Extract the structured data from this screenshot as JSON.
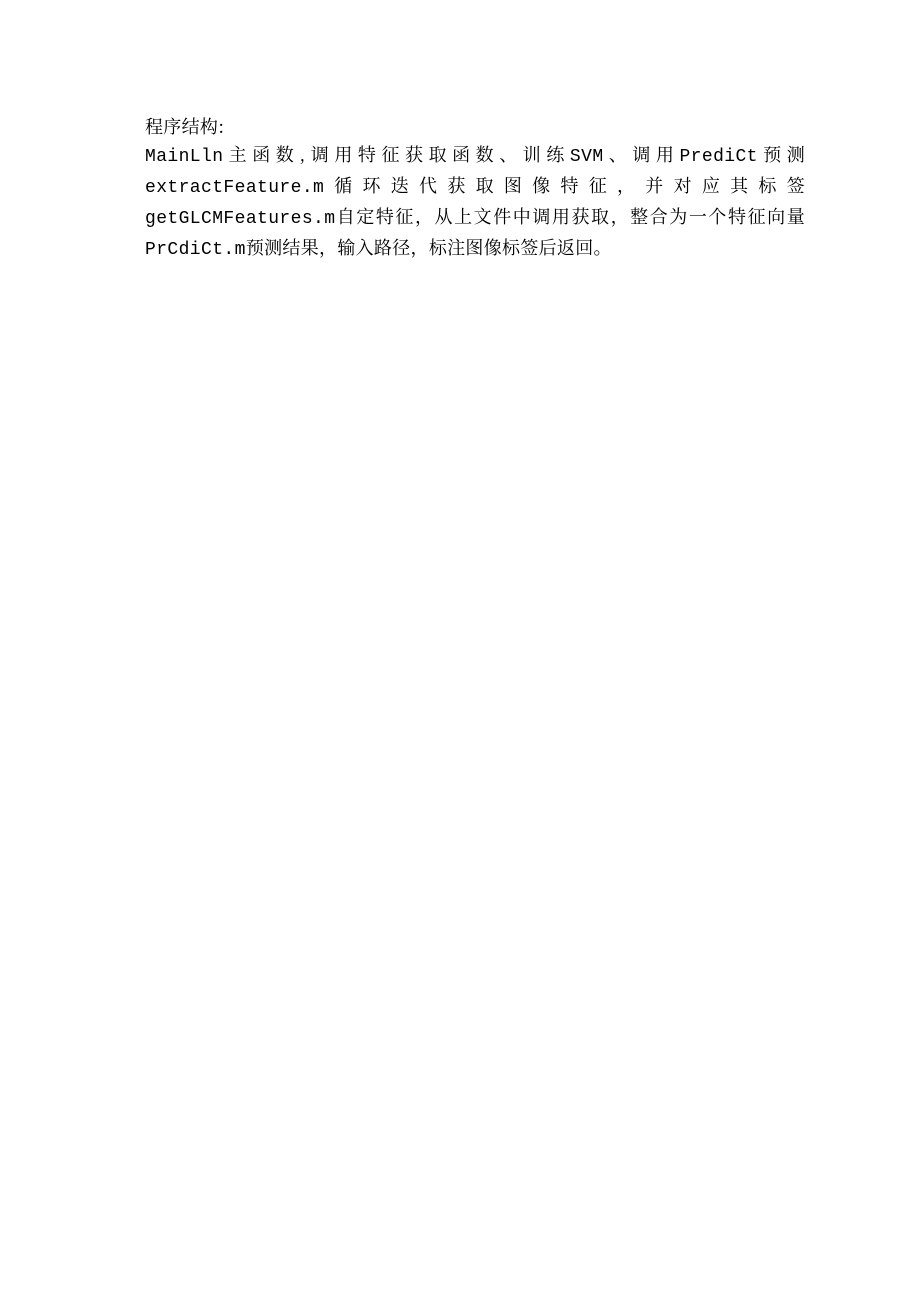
{
  "document": {
    "line1_seg1": "程序结构:",
    "line2_seg1": "MainLln",
    "line2_seg2": "主函数,调用特征获取函数、训练",
    "line2_seg3": "SVM",
    "line2_seg4": "、调用",
    "line2_seg5": "PrediCt",
    "line2_seg6": "预测",
    "line3_seg1": "extractFeature.m",
    "line3_seg2": "循环迭代获取图像特征，并对应其标签",
    "line3_seg3": "getGLCMFeatures.m",
    "line3_seg4": "自定特征，从上文件中调用获取，整合为一个特征向量",
    "line3_seg5": "PrCdiCt.m",
    "line3_seg6": "预测结果，输入路径，标注图像标签后返回。"
  }
}
